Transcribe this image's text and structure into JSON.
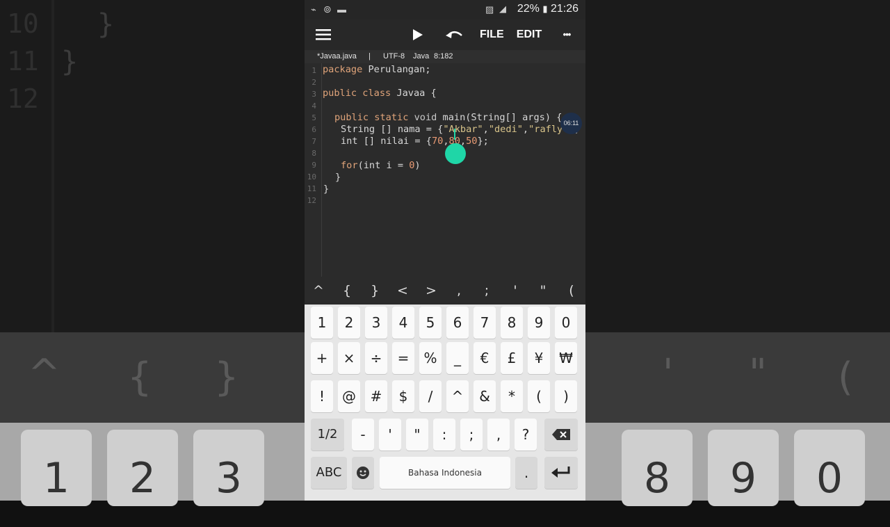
{
  "status": {
    "battery": "22%",
    "time": "21:26"
  },
  "toolbar": {
    "file": "FILE",
    "edit": "EDIT",
    "more": "•••"
  },
  "infobar": {
    "filename": "*Javaa.java",
    "sep": "|",
    "encoding": "UTF-8",
    "language": "Java",
    "position": "8:182"
  },
  "editor": {
    "line_numbers": [
      "1",
      "2",
      "3",
      "4",
      "5",
      "6",
      "7",
      "8",
      "9",
      "10",
      "11",
      "12"
    ],
    "line1": {
      "kw": "package",
      "rest": " Perulangan;"
    },
    "line3": {
      "kw": "public class",
      "rest": " Javaa {"
    },
    "line5": {
      "kw": "public static",
      "kw2": " void",
      "rest": " main(String[] args) {"
    },
    "line6": {
      "pre": "String [] nama = {",
      "s1": "\"Akbar\"",
      "c1": ",",
      "s2": "\"dedi\"",
      "c2": ",",
      "s3": "\"rafly\"",
      "post": "};"
    },
    "line7": {
      "pre": "int [] nilai = {",
      "n1": "70",
      "c1": ",",
      "n2": "80",
      "c2": ",",
      "n3": "50",
      "post": "};"
    },
    "line9": {
      "kw": "for",
      "pre": "(int i = ",
      "n": "0",
      "post": ")"
    },
    "line10": "}",
    "line11": "}",
    "time_badge": "06:11"
  },
  "symbols": [
    "^",
    "{",
    "}",
    "<",
    ">",
    ",",
    ";",
    "'",
    "\"",
    "("
  ],
  "keyboard": {
    "row1": [
      "1",
      "2",
      "3",
      "4",
      "5",
      "6",
      "7",
      "8",
      "9",
      "0"
    ],
    "row2": [
      "+",
      "×",
      "÷",
      "=",
      "%",
      "_",
      "€",
      "£",
      "¥",
      "₩"
    ],
    "row3": [
      "!",
      "@",
      "#",
      "$",
      "/",
      "^",
      "&",
      "*",
      "(",
      ")"
    ],
    "row4": [
      "1/2",
      "-",
      "'",
      "\"",
      ":",
      ";",
      ",",
      "?"
    ],
    "abc": "ABC",
    "space": "Bahasa Indonesia",
    "period": "."
  },
  "background": {
    "line_numbers": [
      "10",
      "11",
      "12"
    ],
    "braces": [
      "}",
      "}"
    ],
    "symbols": [
      "^",
      "{",
      "}",
      "'",
      "\"",
      "("
    ],
    "keys": [
      "1",
      "2",
      "3",
      "8",
      "9",
      "0"
    ]
  }
}
